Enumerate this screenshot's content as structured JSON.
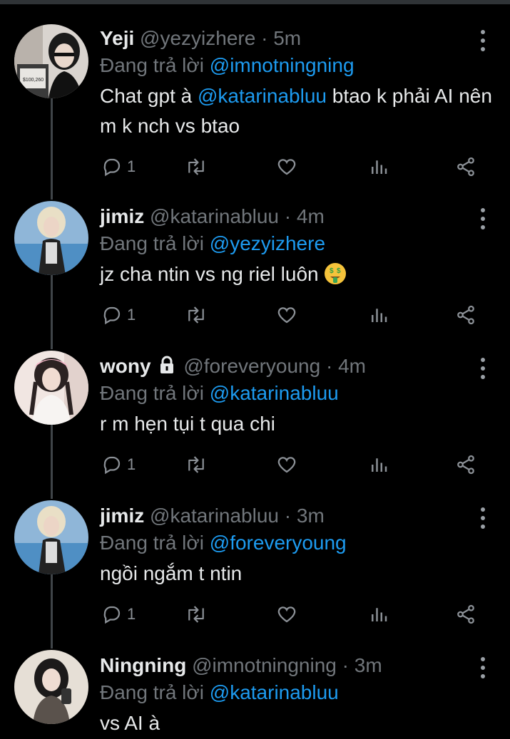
{
  "reply_prefix": "Đang trả lời",
  "tweets": [
    {
      "name": "Yeji",
      "handle": "@yezyizhere",
      "time": "5m",
      "reply_to": "@imnotningning",
      "text_before": "Chat gpt à ",
      "text_mention": "@katarinabluu",
      "text_after": " btao k phải AI nên m k nch vs btao",
      "reply_count": "1",
      "avatar_caption": "$100,260"
    },
    {
      "name": "jimiz",
      "handle": "@katarinabluu",
      "time": "4m",
      "reply_to": "@yezyizhere",
      "text": "jz cha ntin vs ng riel luôn",
      "emoji": "money-mouth-face",
      "reply_count": "1"
    },
    {
      "name": "wony",
      "handle": "@foreveryoung",
      "time": "4m",
      "reply_to": "@katarinabluu",
      "text": "r m hẹn tụi t qua chi",
      "reply_count": "1",
      "protected": true
    },
    {
      "name": "jimiz",
      "handle": "@katarinabluu",
      "time": "3m",
      "reply_to": "@foreveryoung",
      "text": "ngồi ngắm t ntin",
      "reply_count": "1"
    },
    {
      "name": "Ningning",
      "handle": "@imnotningning",
      "time": "3m",
      "reply_to": "@katarinabluu",
      "text": "vs AI à"
    }
  ],
  "icons": {
    "reply": "reply-icon",
    "retweet": "retweet-icon",
    "like": "heart-icon",
    "views": "views-icon",
    "share": "share-icon",
    "menu": "more-vertical-icon",
    "lock": "lock-icon"
  },
  "colors": {
    "background": "#000000",
    "primary_text": "#e7e9ea",
    "secondary_text": "#71767b",
    "accent": "#1d9bf0",
    "thread_line": "#3f4448"
  }
}
